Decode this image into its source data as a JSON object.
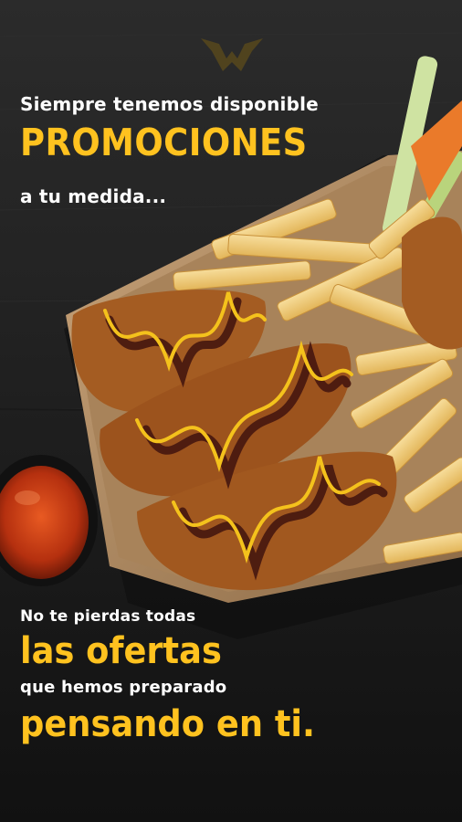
{
  "promo": {
    "headline_top": "Siempre tenemos disponible",
    "headline_main": "PROMOCIONES",
    "headline_sub": "a tu medida...",
    "footer_line1": "No te pierdas todas",
    "footer_line2": "las ofertas",
    "footer_line3": "que hemos preparado",
    "footer_line4": "pensando en ti."
  },
  "colors": {
    "accent": "#ffc21f",
    "text": "#ffffff",
    "background": "#222222"
  },
  "icons": {
    "logo": "brand-wing-logo-icon"
  }
}
